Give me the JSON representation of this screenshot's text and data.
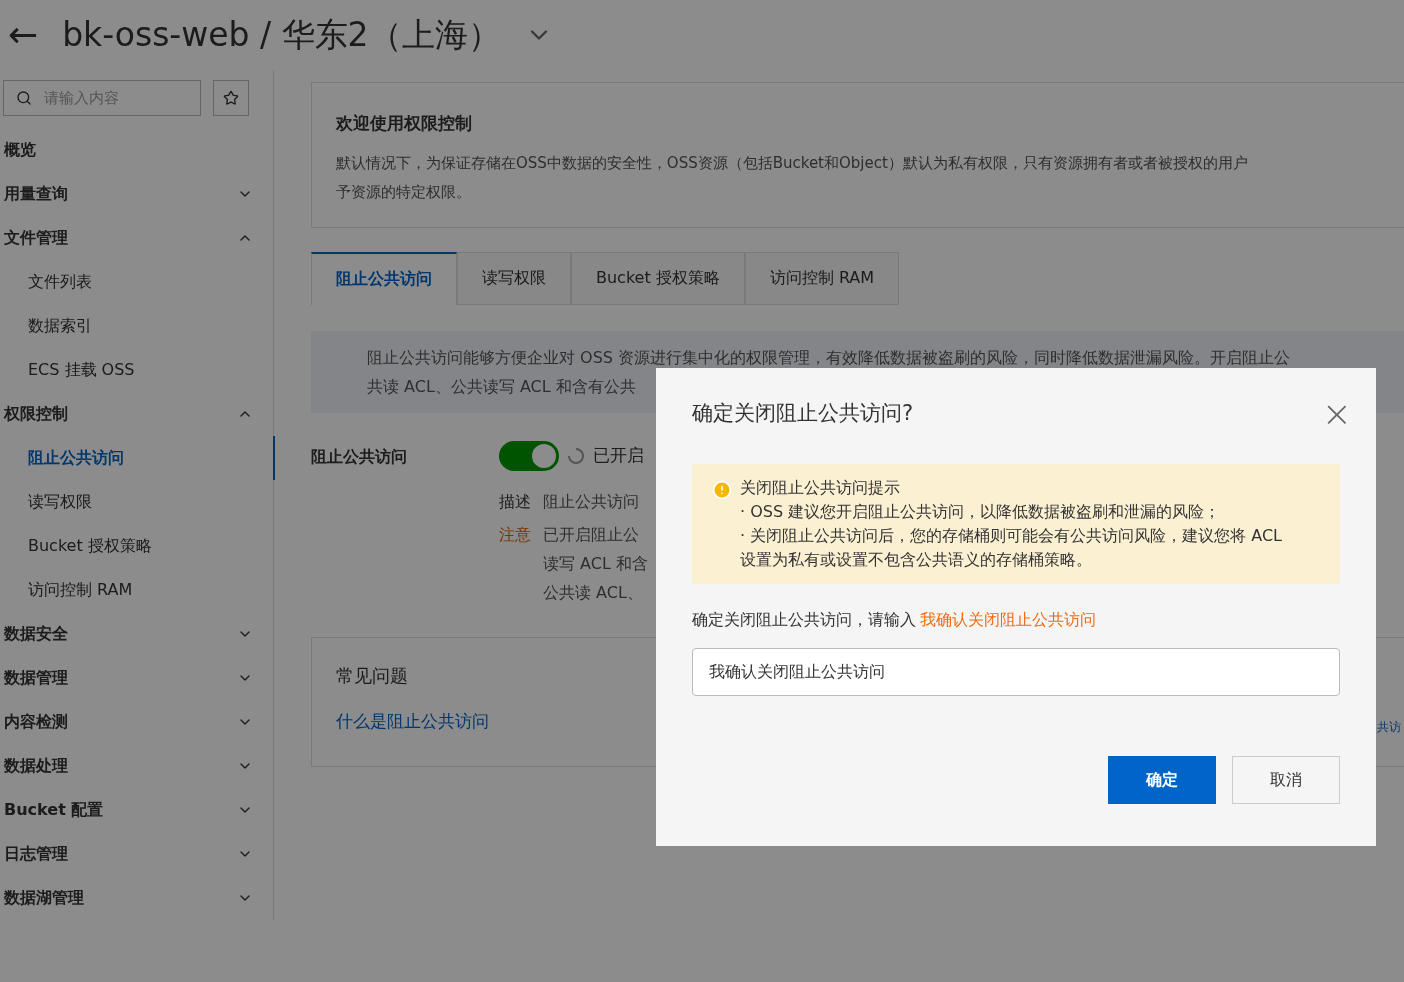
{
  "header": {
    "back": "←",
    "title": "bk-oss-web / 华东2（上海）"
  },
  "sidebar": {
    "search": {
      "placeholder": "请输入内容"
    },
    "items": [
      {
        "label": "概览",
        "kind": "link"
      },
      {
        "label": "用量查询",
        "kind": "group",
        "expanded": false
      },
      {
        "label": "文件管理",
        "kind": "group",
        "expanded": true,
        "children": [
          {
            "label": "文件列表",
            "selected": false
          },
          {
            "label": "数据索引",
            "selected": false
          },
          {
            "label": "ECS 挂载 OSS",
            "selected": false
          }
        ]
      },
      {
        "label": "权限控制",
        "kind": "group",
        "expanded": true,
        "children": [
          {
            "label": "阻止公共访问",
            "selected": true
          },
          {
            "label": "读写权限",
            "selected": false
          },
          {
            "label": "Bucket 授权策略",
            "selected": false
          },
          {
            "label": "访问控制 RAM",
            "selected": false
          }
        ]
      },
      {
        "label": "数据安全",
        "kind": "group",
        "expanded": false
      },
      {
        "label": "数据管理",
        "kind": "group",
        "expanded": false
      },
      {
        "label": "内容检测",
        "kind": "group",
        "expanded": false
      },
      {
        "label": "数据处理",
        "kind": "group",
        "expanded": false
      },
      {
        "label": "Bucket 配置",
        "kind": "group",
        "expanded": false
      },
      {
        "label": "日志管理",
        "kind": "group",
        "expanded": false
      },
      {
        "label": "数据湖管理",
        "kind": "group",
        "expanded": false
      }
    ]
  },
  "welcome": {
    "title": "欢迎使用权限控制",
    "text": "默认情况下，为保证存储在OSS中数据的安全性，OSS资源（包括Bucket和Object）默认为私有权限，只有资源拥有者或者被授权的用户",
    "text_2": "予资源的特定权限。"
  },
  "tabs": [
    {
      "label": "阻止公共访问",
      "selected": true
    },
    {
      "label": "读写权限",
      "selected": false
    },
    {
      "label": "Bucket 授权策略",
      "selected": false
    },
    {
      "label": "访问控制 RAM",
      "selected": false
    }
  ],
  "info": [
    "阻止公共访问能够方便企业对 OSS 资源进行集中化的权限管理，有效降低数据被盗刷的风险，同时降低数据泄漏风险。开启阻止公",
    "共读 ACL、公共读写 ACL 和含有公共"
  ],
  "setting": {
    "label": "阻止公共访问",
    "on": true,
    "status": "已开启",
    "desc_label": "描述",
    "desc": "阻止公共访问",
    "note_label": "注意",
    "note": [
      "已开启阻止公",
      "读写 ACL 和含",
      "公共读 ACL、"
    ]
  },
  "faq": {
    "title": "常见问题",
    "links": [
      "什么是阻止公共访问",
      "共访"
    ]
  },
  "dialog": {
    "title": "确定关闭阻止公共访问?",
    "close": "×",
    "warning": {
      "title": "关闭阻止公共访问提示",
      "lines": [
        "· OSS 建议您开启阻止公共访问，以降低数据被盗刷和泄漏的风险；",
        "· 关闭阻止公共访问后，您的存储桶则可能会有公共访问风险，建议您将 ACL 设置为私有或设置不包含公共语义的存储桶策略。"
      ]
    },
    "prompt": "确定关闭阻止公共访问，请输入",
    "phrase": "我确认关闭阻止公共访问",
    "input": {
      "value": "我确认关闭阻止公共访问"
    },
    "buttons": [
      {
        "label": "确定",
        "kind": "primary"
      },
      {
        "label": "取消",
        "kind": "secondary"
      }
    ]
  }
}
